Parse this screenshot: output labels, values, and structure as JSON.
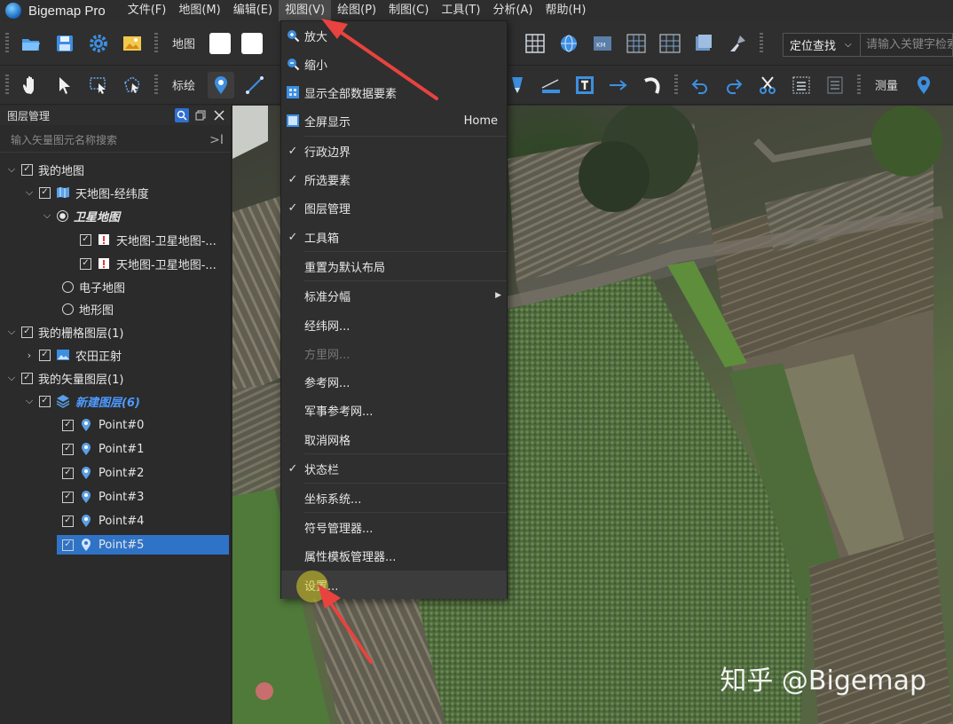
{
  "app": {
    "name": "Bigemap Pro"
  },
  "menu": [
    "文件(F)",
    "地图(M)",
    "编辑(E)",
    "视图(V)",
    "绘图(P)",
    "制图(C)",
    "工具(T)",
    "分析(A)",
    "帮助(H)"
  ],
  "toolbar1": {
    "map_label": "地图",
    "locate_label": "定位查找",
    "search_placeholder": "请输入关键字检索"
  },
  "toolbar2": {
    "annotate_label": "标绘",
    "measure_label": "测量"
  },
  "layer_panel": {
    "title": "图层管理",
    "search_placeholder": "输入矢量图元名称搜索",
    "tree": [
      "我的地图",
      "天地图-经纬度",
      "卫星地图",
      "天地图-卫星地图-...",
      "天地图-卫星地图-...",
      "电子地图",
      "地形图",
      "我的栅格图层(1)",
      "农田正射",
      "我的矢量图层(1)",
      "新建图层(6)",
      "Point#0",
      "Point#1",
      "Point#2",
      "Point#3",
      "Point#4",
      "Point#5"
    ]
  },
  "view_menu": {
    "items": [
      {
        "label": "放大"
      },
      {
        "label": "缩小"
      },
      {
        "label": "显示全部数据要素"
      },
      {
        "label": "全屏显示",
        "shortcut": "Home"
      },
      {
        "label": "行政边界",
        "checked": true
      },
      {
        "label": "所选要素",
        "checked": true
      },
      {
        "label": "图层管理",
        "checked": true
      },
      {
        "label": "工具箱",
        "checked": true
      },
      {
        "label": "重置为默认布局"
      },
      {
        "label": "标准分幅",
        "submenu": true
      },
      {
        "label": "经纬网..."
      },
      {
        "label": "方里网...",
        "disabled": true
      },
      {
        "label": "参考网..."
      },
      {
        "label": "军事参考网..."
      },
      {
        "label": "取消网格"
      },
      {
        "label": "状态栏",
        "checked": true
      },
      {
        "label": "坐标系统..."
      },
      {
        "label": "符号管理器..."
      },
      {
        "label": "属性模板管理器..."
      },
      {
        "label": "设置..."
      }
    ]
  },
  "watermark": "知乎 @Bigemap",
  "colors": {
    "selection": "#2f73c7",
    "accent": "#2f6fd1",
    "annotation_arrow": "#e8433f"
  }
}
